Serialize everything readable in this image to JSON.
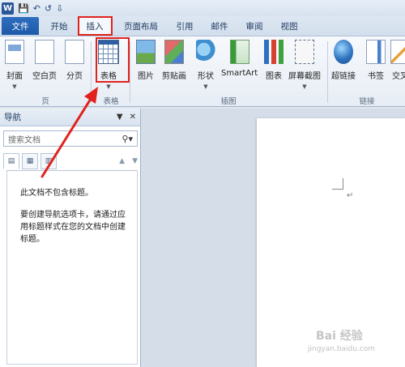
{
  "qat": {
    "app_letter": "W",
    "save": "💾",
    "undo": "↶",
    "redo": "↺",
    "customize": "⇩"
  },
  "tabs": [
    "文件",
    "开始",
    "插入",
    "页面布局",
    "引用",
    "邮件",
    "审阅",
    "视图"
  ],
  "ribbon": {
    "buttons": [
      "封面",
      "空白页",
      "分页",
      "表格",
      "图片",
      "剪贴画",
      "形状",
      "SmartArt",
      "图表",
      "屏幕截图",
      "超链接",
      "书签",
      "交叉"
    ],
    "groups": [
      "页",
      "表格",
      "插图",
      "链接"
    ]
  },
  "nav": {
    "title": "导航",
    "search_placeholder": "搜索文档",
    "message1": "此文档不包含标题。",
    "message2": "要创建导航选项卡，请通过应用标题样式在您的文档中创建标题。"
  },
  "doc": {
    "para_mark": "↵"
  },
  "watermark": {
    "text": "Bai 经验",
    "url": "jingyan.baidu.com"
  },
  "colors": {
    "highlight": "#e0231c",
    "file_tab": "#1d5aa8"
  }
}
